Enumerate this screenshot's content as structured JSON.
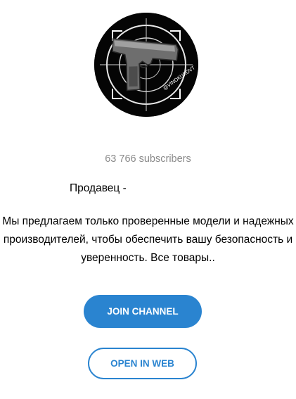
{
  "channel": {
    "avatar_icon": "pistol-logo-icon",
    "watermark": "@VINOKUROVT",
    "subscribers": "63 766 subscribers",
    "title": "Продавец -",
    "description": "Мы предлагаем только проверенные модели и надежных производителей, чтобы обеспечить вашу безопасность и уверенность. Все товары.."
  },
  "actions": {
    "join_label": "JOIN CHANNEL",
    "open_web_label": "OPEN IN WEB"
  },
  "colors": {
    "accent": "#2a84d0",
    "muted_text": "#8a8a8a"
  }
}
